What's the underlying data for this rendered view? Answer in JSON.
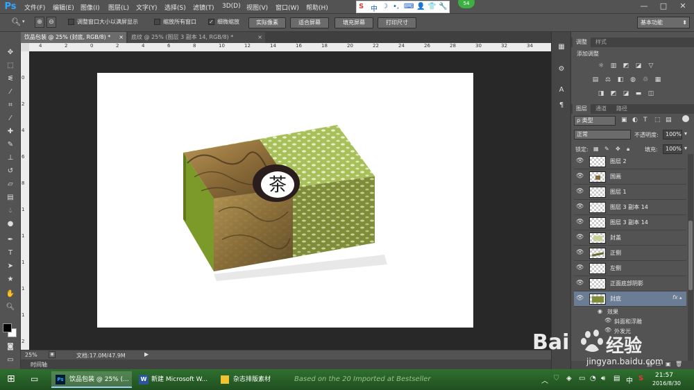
{
  "app": {
    "logo": "Ps",
    "menu": [
      "文件(F)",
      "编辑(E)",
      "图像(I)",
      "图层(L)",
      "文字(Y)",
      "选择(S)",
      "滤镜(T)",
      "3D(D)",
      "视图(V)",
      "窗口(W)",
      "帮助(H)"
    ],
    "ime_chars": [
      "S",
      "中",
      "☽",
      "•,",
      "⌨",
      "👤",
      "👕",
      "🔧"
    ],
    "badge": "54",
    "window_controls": [
      "—",
      "□",
      "✕"
    ]
  },
  "options": {
    "resize_windows": "调整窗口大小以满屏显示",
    "zoom_all": "缩放所有窗口",
    "scrubby_zoom": "细微缩放",
    "actual_pixels": "实际像素",
    "fit_screen": "适合屏幕",
    "fill_screen": "填充屏幕",
    "print_size": "打印尺寸",
    "workspace": "基本功能"
  },
  "tabs": [
    {
      "label": "饮品包装 @ 25% (封底, RGB/8) *"
    },
    {
      "label": "底纹 @ 25% (图层 3 副本 14, RGB/8) *"
    }
  ],
  "ruler_top": [
    "4",
    "2",
    "0",
    "2",
    "4",
    "6",
    "8",
    "10",
    "12",
    "14",
    "16",
    "18",
    "20",
    "22",
    "24",
    "26",
    "28",
    "30",
    "32",
    "34"
  ],
  "ruler_left": [
    "0",
    "2",
    "4",
    "6",
    "8",
    "1",
    "1",
    "1",
    "1",
    "1",
    "2"
  ],
  "artwork": {
    "character": "茶"
  },
  "status": {
    "zoom": "25%",
    "doc": "文档:17.0M/47.9M"
  },
  "timeline": "时间轴",
  "adjustments": {
    "tabs": [
      "调整",
      "样式"
    ],
    "add": "添加调整"
  },
  "layers_panel": {
    "tabs": [
      "图层",
      "通道",
      "路径"
    ],
    "filter_kind": "ρ 类型",
    "blend_mode": "正常",
    "opacity_label": "不透明度:",
    "opacity": "100%",
    "lock_label": "锁定:",
    "fill_label": "填充:",
    "fill": "100%",
    "layers": [
      "图层 2",
      "国画",
      "图层 1",
      "图层 3 副本 14",
      "图层 3 副本 14",
      "封盖",
      "正侧",
      "左侧",
      "正面底部阴影",
      "封底"
    ],
    "fx": "fx",
    "effects_label": "效果",
    "effects": [
      "斜面和浮雕",
      "外发光"
    ]
  },
  "taskbar": {
    "items": [
      "饮品包装 @ 25% (...",
      "新建 Microsoft W...",
      "杂志排版素材"
    ],
    "bg_text": "Based on the 20 Imported at Bestseller",
    "ime": "中",
    "time": "21:57",
    "date": "2016/8/30"
  },
  "watermark": {
    "brand": "Bai",
    "brand2": "经验",
    "url": "jingyan.baidu.com"
  }
}
